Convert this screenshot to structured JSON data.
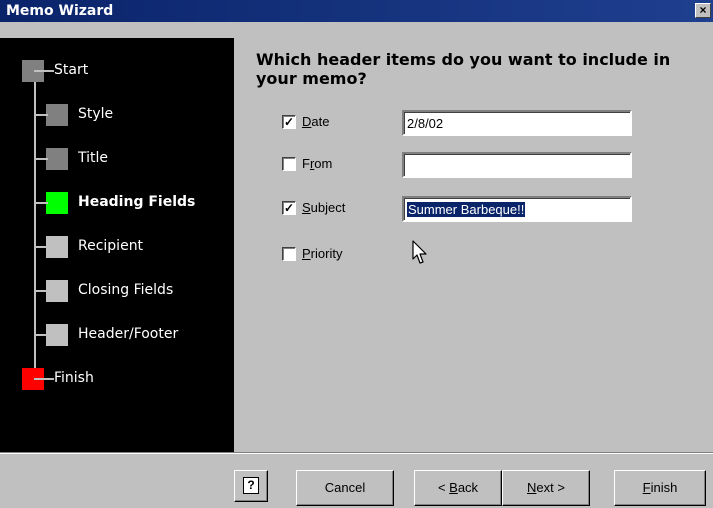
{
  "window": {
    "title": "Memo Wizard",
    "close_glyph": "×"
  },
  "sidebar": {
    "steps": [
      {
        "label": "Start",
        "color": "#808080",
        "active": false
      },
      {
        "label": "Style",
        "color": "#808080",
        "active": false
      },
      {
        "label": "Title",
        "color": "#808080",
        "active": false
      },
      {
        "label": "Heading Fields",
        "color": "#00ff00",
        "active": true
      },
      {
        "label": "Recipient",
        "color": "#c0c0c0",
        "active": false
      },
      {
        "label": "Closing Fields",
        "color": "#c0c0c0",
        "active": false
      },
      {
        "label": "Header/Footer",
        "color": "#c0c0c0",
        "active": false
      },
      {
        "label": "Finish",
        "color": "#ff0000",
        "active": false
      }
    ]
  },
  "main": {
    "question": "Which header items do you want to include in your memo?",
    "fields": {
      "date": {
        "label_hotkey": "D",
        "label_rest": "ate",
        "checked": true,
        "value": "2/8/02"
      },
      "from": {
        "label_pre": "F",
        "label_hotkey": "r",
        "label_rest": "om",
        "checked": false,
        "value": ""
      },
      "subject": {
        "label_hotkey": "S",
        "label_rest": "ubject",
        "checked": true,
        "value": "Summer Barbeque!!"
      },
      "priority": {
        "label_hotkey": "P",
        "label_rest": "riority",
        "checked": false
      }
    },
    "check_glyph": "✓"
  },
  "buttons": {
    "help": "?",
    "cancel": "Cancel",
    "back_prefix": "< ",
    "back_hotkey": "B",
    "back_rest": "ack",
    "next_hotkey": "N",
    "next_rest": "ext >",
    "finish_hotkey": "F",
    "finish_rest": "inish"
  },
  "icons": {
    "help": "help-icon",
    "cursor": "mouse-pointer-icon"
  }
}
